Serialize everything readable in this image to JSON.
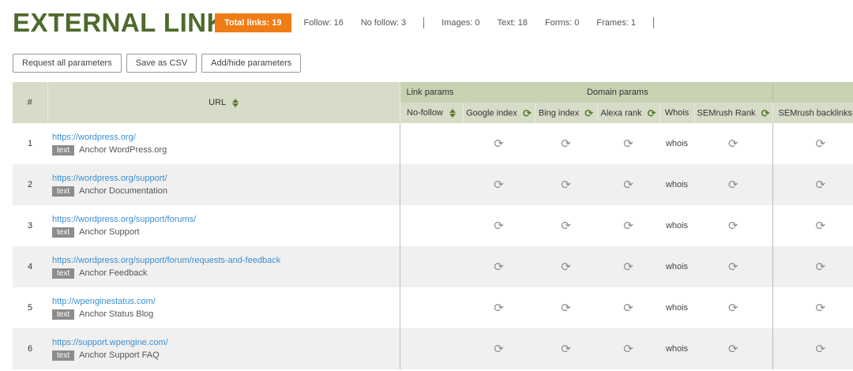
{
  "header": {
    "title": "EXTERNAL LINKS",
    "total_links": "Total links: 19",
    "follow": "Follow: 16",
    "nofollow": "No follow: 3",
    "images": "Images: 0",
    "text": "Text: 18",
    "forms": "Forms: 0",
    "frames": "Frames: 1"
  },
  "toolbar": {
    "request_all": "Request all parameters",
    "save_csv": "Save as CSV",
    "add_hide": "Add/hide parameters"
  },
  "table": {
    "col_num": "#",
    "col_url": "URL",
    "group_link": "Link params",
    "group_domain": "Domain params",
    "col_nofollow": "No-follow",
    "col_google": "Google index",
    "col_bing": "Bing index",
    "col_alexa": "Alexa rank",
    "col_whois": "Whois",
    "col_semrush_rank": "SEMrush Rank",
    "col_semrush_backlinks": "SEMrush backlinks",
    "whois_label": "whois",
    "rows": [
      {
        "num": "1",
        "url": "https://wordpress.org/",
        "type": "text",
        "anchor": "Anchor WordPress.org"
      },
      {
        "num": "2",
        "url": "https://wordpress.org/support/",
        "type": "text",
        "anchor": "Anchor Documentation"
      },
      {
        "num": "3",
        "url": "https://wordpress.org/support/forums/",
        "type": "text",
        "anchor": "Anchor Support"
      },
      {
        "num": "4",
        "url": "https://wordpress.org/support/forum/requests-and-feedback",
        "type": "text",
        "anchor": "Anchor Feedback"
      },
      {
        "num": "5",
        "url": "http://wpenginestatus.com/",
        "type": "text",
        "anchor": "Anchor Status Blog"
      },
      {
        "num": "6",
        "url": "https://support.wpengine.com/",
        "type": "text",
        "anchor": "Anchor Support FAQ"
      }
    ]
  },
  "icons": {
    "refresh": "refresh-icon",
    "sort": "sort-icon"
  },
  "colors": {
    "title": "#4e6a2c",
    "badge": "#f07c15",
    "link": "#3a8fd4",
    "header_bg": "#d7dcc8"
  }
}
